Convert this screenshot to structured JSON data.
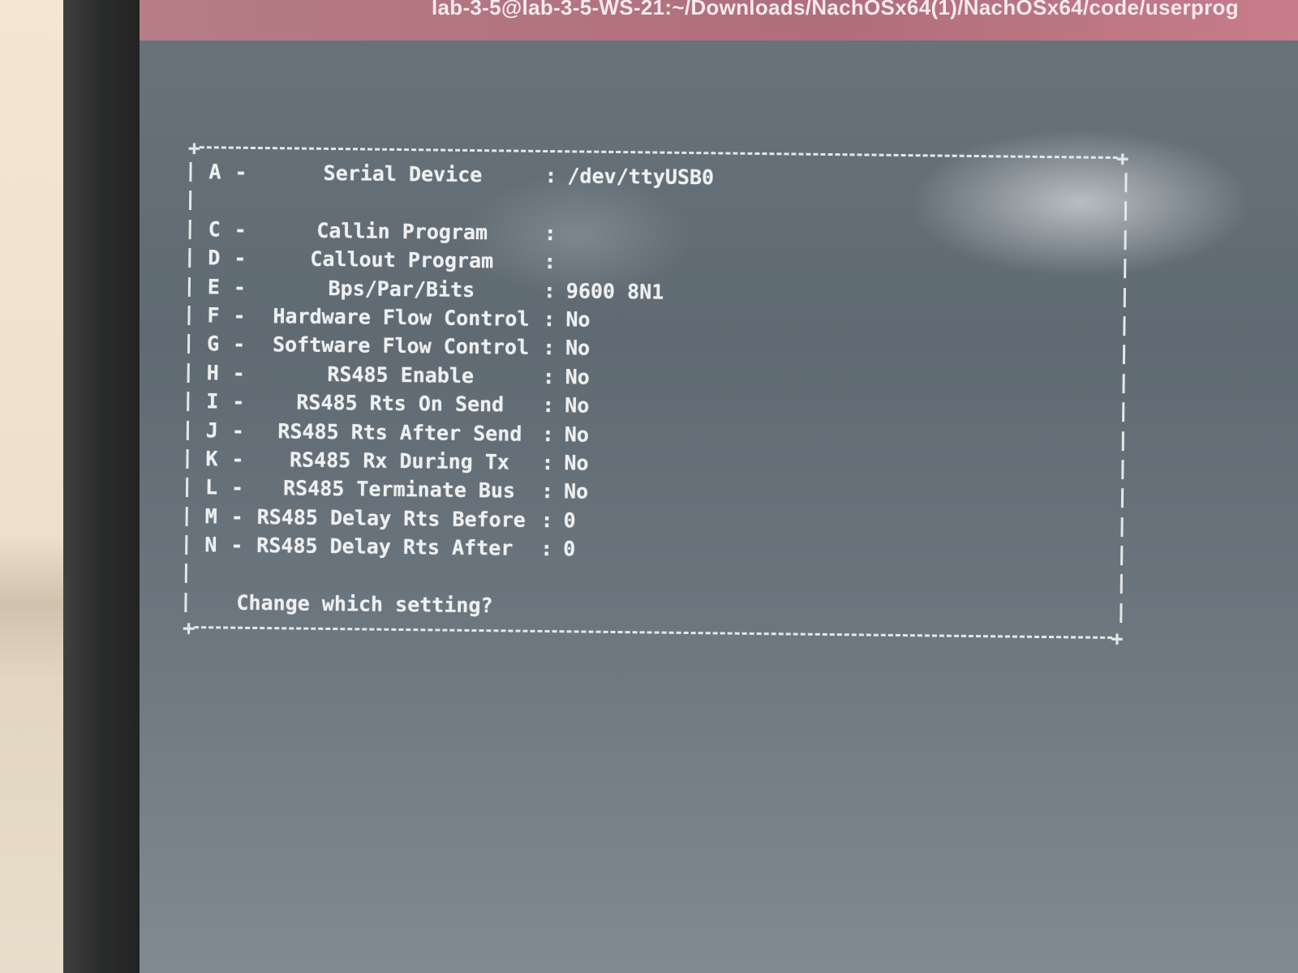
{
  "window": {
    "title": "lab-3-5@lab-3-5-WS-21:~/Downloads/NachOSx64(1)/NachOSx64/code/userprog"
  },
  "menu": {
    "settings": [
      {
        "key": "A",
        "label": "Serial Device",
        "value": "/dev/ttyUSB0"
      },
      {
        "key": "C",
        "label": "Callin Program",
        "value": ""
      },
      {
        "key": "D",
        "label": "Callout Program",
        "value": ""
      },
      {
        "key": "E",
        "label": "Bps/Par/Bits",
        "value": "9600 8N1"
      },
      {
        "key": "F",
        "label": "Hardware Flow Control",
        "value": "No"
      },
      {
        "key": "G",
        "label": "Software Flow Control",
        "value": "No"
      },
      {
        "key": "H",
        "label": "RS485 Enable",
        "value": "No"
      },
      {
        "key": "I",
        "label": "RS485 Rts On Send",
        "value": "No"
      },
      {
        "key": "J",
        "label": "RS485 Rts After Send",
        "value": "No"
      },
      {
        "key": "K",
        "label": "RS485 Rx During Tx",
        "value": "No"
      },
      {
        "key": "L",
        "label": "RS485 Terminate Bus",
        "value": "No"
      },
      {
        "key": "M",
        "label": "RS485 Delay Rts Before",
        "value": "0"
      },
      {
        "key": "N",
        "label": "RS485 Delay Rts After",
        "value": "0"
      }
    ],
    "separator": "-",
    "colon": ":",
    "corner": "+",
    "prompt": "Change which setting?"
  }
}
